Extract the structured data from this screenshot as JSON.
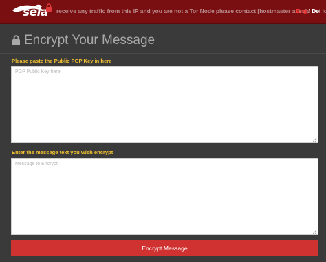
{
  "header": {
    "logo_text": "sela",
    "notice": "receive any traffic from this IP and you are not a Tor Node please contact [hostmaster at sela dot io]",
    "lang_active": "Eng",
    "lang_sep": "/",
    "lang_other": "De"
  },
  "page": {
    "title": "Encrypt Your Message"
  },
  "form": {
    "key_label": "Please paste the Public PGP Key in here",
    "key_placeholder": "PGP Public Key here",
    "message_label": "Enter the message text you wish encrypt",
    "message_placeholder": "Message to Encrypt",
    "submit_label": "Encrypt Message"
  },
  "colors": {
    "header_bg": "#7a0f12",
    "page_bg": "#3a3a3a",
    "label": "#f2c230",
    "button": "#cf3230",
    "lang_active": "#ff3b3b"
  }
}
